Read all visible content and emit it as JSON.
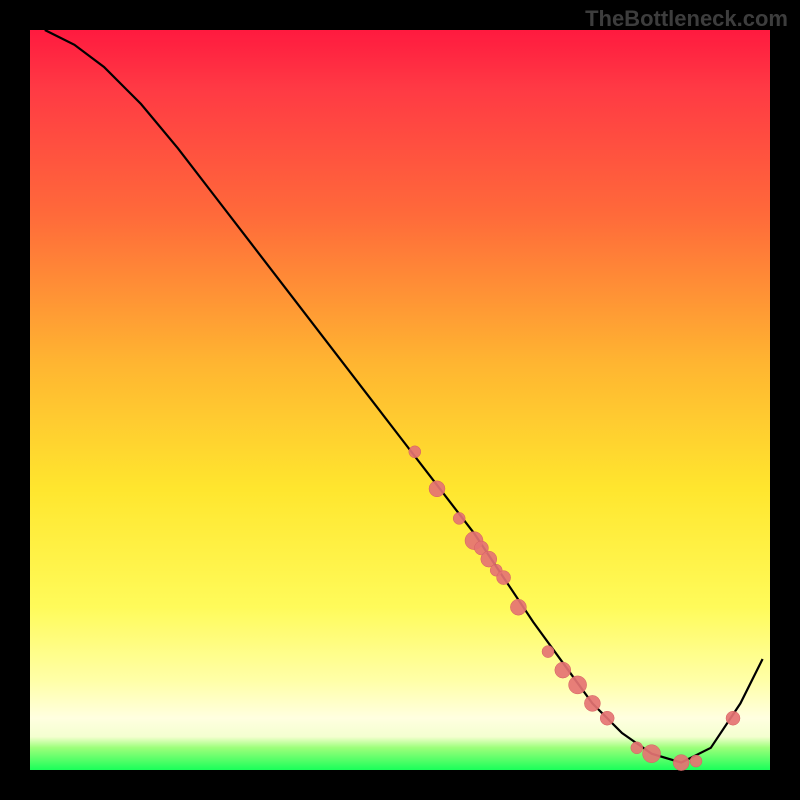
{
  "watermark": "TheBottleneck.com",
  "colors": {
    "frame": "#000000",
    "gradient_top": "#ff1a3f",
    "gradient_mid": "#ffe62e",
    "gradient_bottom": "#1aff5a",
    "curve": "#000000",
    "marker_fill": "#e57373",
    "marker_stroke": "#d46060"
  },
  "chart_data": {
    "type": "line",
    "title": "",
    "xlabel": "",
    "ylabel": "",
    "xlim": [
      0,
      100
    ],
    "ylim": [
      0,
      100
    ],
    "x": [
      2,
      6,
      10,
      15,
      20,
      25,
      30,
      35,
      40,
      45,
      50,
      55,
      60,
      64,
      68,
      72,
      76,
      80,
      84,
      88,
      92,
      96,
      99
    ],
    "values": [
      100,
      98,
      95,
      90,
      84,
      77.5,
      71,
      64.5,
      58,
      51.5,
      45,
      38.5,
      32,
      26,
      20,
      14.5,
      9,
      5,
      2.2,
      1,
      3,
      9,
      15
    ],
    "series": [
      {
        "name": "markers",
        "x": [
          52,
          55,
          58,
          60,
          61,
          62,
          63,
          64,
          66,
          70,
          72,
          74,
          76,
          78,
          82,
          84,
          88,
          90,
          95
        ],
        "values": [
          43,
          38,
          34,
          31,
          30,
          28.5,
          27,
          26,
          22,
          16,
          13.5,
          11.5,
          9,
          7,
          3,
          2.2,
          1,
          1.2,
          7
        ],
        "sizes": [
          6,
          8,
          6,
          9,
          7,
          8,
          6,
          7,
          8,
          6,
          8,
          9,
          8,
          7,
          6,
          9,
          8,
          6,
          7
        ]
      }
    ]
  }
}
